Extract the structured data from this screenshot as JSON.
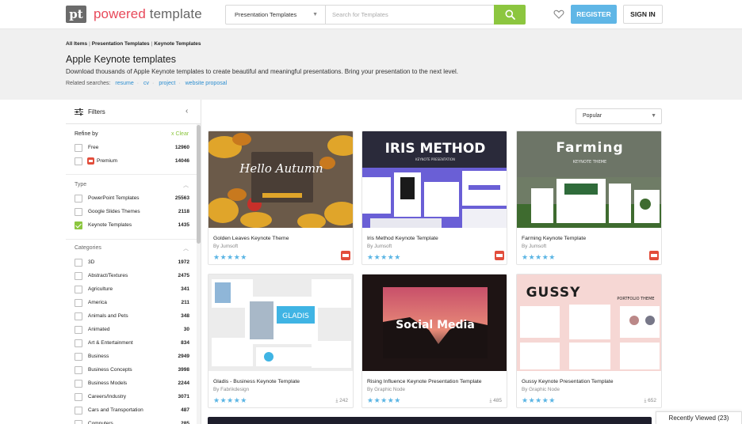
{
  "header": {
    "logo_mark": "pt",
    "logo_word1": "powered",
    "logo_word2": "template",
    "search_category": "Presentation Templates",
    "search_placeholder": "Search for Templates",
    "register_label": "REGISTER",
    "signin_label": "SIGN IN"
  },
  "breadcrumb": [
    "All Items",
    "Presentation Templates",
    "Keynote Templates"
  ],
  "page": {
    "title": "Apple Keynote templates",
    "description": "Download thousands of Apple Keynote templates to create beautiful and meaningful presentations. Bring your presentation to the next level.",
    "related_label": "Related searches:",
    "related": [
      "resume",
      "cv",
      "project",
      "website proposal"
    ]
  },
  "filters": {
    "heading": "Filters",
    "refine_label": "Refine by",
    "clear_label": "x Clear",
    "refine": [
      {
        "label": "Free",
        "count": "12960",
        "checked": false
      },
      {
        "label": "Premium",
        "count": "14046",
        "checked": false
      }
    ],
    "type_label": "Type",
    "type": [
      {
        "label": "PowerPoint Templates",
        "count": "25563",
        "checked": false
      },
      {
        "label": "Google Slides Themes",
        "count": "2118",
        "checked": false
      },
      {
        "label": "Keynote Templates",
        "count": "1435",
        "checked": true
      }
    ],
    "categories_label": "Categories",
    "categories": [
      {
        "label": "3D",
        "count": "1972"
      },
      {
        "label": "Abstract/Textures",
        "count": "2475"
      },
      {
        "label": "Agriculture",
        "count": "341"
      },
      {
        "label": "America",
        "count": "211"
      },
      {
        "label": "Animals and Pets",
        "count": "348"
      },
      {
        "label": "Animated",
        "count": "30"
      },
      {
        "label": "Art & Entertainment",
        "count": "834"
      },
      {
        "label": "Business",
        "count": "2949"
      },
      {
        "label": "Business Concepts",
        "count": "3998"
      },
      {
        "label": "Business Models",
        "count": "2244"
      },
      {
        "label": "Careers/Industry",
        "count": "3071"
      },
      {
        "label": "Cars and Transportation",
        "count": "487"
      },
      {
        "label": "Computers",
        "count": "285"
      }
    ]
  },
  "sort": {
    "selected": "Popular"
  },
  "cards": [
    {
      "title": "Golden Leaves Keynote Theme",
      "author": "By Jumsoft",
      "rating": 4.5,
      "premium": true,
      "downloads": "",
      "thumb_text": "Hello Autumn",
      "thumb_sub": ""
    },
    {
      "title": "Iris Method Keynote Template",
      "author": "By Jumsoft",
      "rating": 5,
      "premium": true,
      "downloads": "",
      "thumb_text": "IRIS METHOD",
      "thumb_sub": "KEYNOTE PRESENTATION"
    },
    {
      "title": "Farming Keynote Template",
      "author": "By Jumsoft",
      "rating": 4.5,
      "premium": true,
      "downloads": "",
      "thumb_text": "Farming",
      "thumb_sub": "KEYNOTE THEME"
    },
    {
      "title": "Gladis - Business Keynote Template",
      "author": "By Fabrikdesign",
      "rating": 4.5,
      "premium": false,
      "downloads": "242",
      "thumb_text": "GLADIS",
      "thumb_sub": ""
    },
    {
      "title": "Rising Influence Keynote Presentation Template",
      "author": "By Graphic Node",
      "rating": 4.5,
      "premium": false,
      "downloads": "485",
      "thumb_text": "Social Media",
      "thumb_sub": ""
    },
    {
      "title": "Gussy Keynote Presentation Template",
      "author": "By Graphic Node",
      "rating": 4.5,
      "premium": false,
      "downloads": "652",
      "thumb_text": "GUSSY",
      "thumb_sub": "PORTFOLIO THEME"
    }
  ],
  "recently_viewed": "Recently Viewed (23)",
  "colors": {
    "brand": "#e8495a",
    "accent_green": "#8cc63f",
    "accent_blue": "#5fb6e6",
    "stars": "#5bb5e4",
    "premium": "#e24d3b"
  }
}
